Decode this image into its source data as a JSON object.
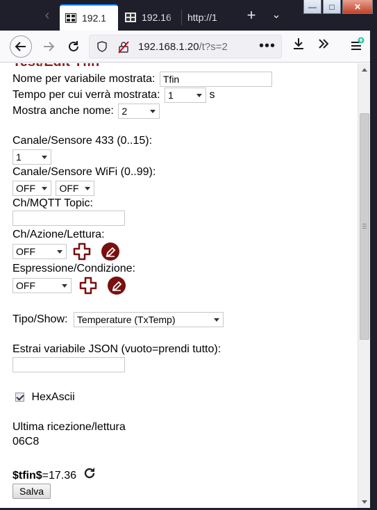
{
  "browser": {
    "tabs": [
      {
        "label": "192.1",
        "active": true
      },
      {
        "label": "192.16",
        "active": false
      },
      {
        "label": "http://1",
        "active": false
      }
    ],
    "new_tab_icon": "plus-icon",
    "url_host": "192.168.1.20",
    "url_path": "/t?s=2",
    "url_more": "•••",
    "window_controls": {
      "minimize": "—",
      "maximize": "□",
      "close": "✕"
    }
  },
  "form": {
    "heading_partial": "Test/Edit Tfin",
    "var_name_label": "Nome per variabile mostrata:",
    "var_name_value": "Tfin",
    "display_time_label": "Tempo per cui verrà mostrata:",
    "display_time_value": "1",
    "display_time_unit": "s",
    "show_name_label": "Mostra anche nome:",
    "show_name_value": "2",
    "ch433_label": "Canale/Sensore 433 (0..15):",
    "ch433_value": "1",
    "wifi_label": "Canale/Sensore WiFi (0..99):",
    "wifi_value_1": "OFF",
    "wifi_value_2": "OFF",
    "mqtt_label": "Ch/MQTT Topic:",
    "mqtt_value": "",
    "action_label": "Ch/Azione/Lettura:",
    "action_value": "OFF",
    "expr_label": "Espressione/Condizione:",
    "expr_value": "OFF",
    "type_label": "Tipo/Show:",
    "type_value": "Temperature (TxTemp)",
    "json_label": "Estrai variabile JSON (vuoto=prendi tutto):",
    "json_value": "",
    "hexascii_label": "HexAscii",
    "hexascii_checked": true,
    "last_rx_label": "Ultima ricezione/lettura",
    "last_rx_value": "06C8",
    "var_display_name": "$tfin$",
    "var_display_value": "=17.36",
    "save_label": "Salva"
  },
  "colors": {
    "accent_red": "#7a0f0f",
    "tab_bar": "#1f1f2b",
    "focus_blue": "#0a84ff"
  }
}
